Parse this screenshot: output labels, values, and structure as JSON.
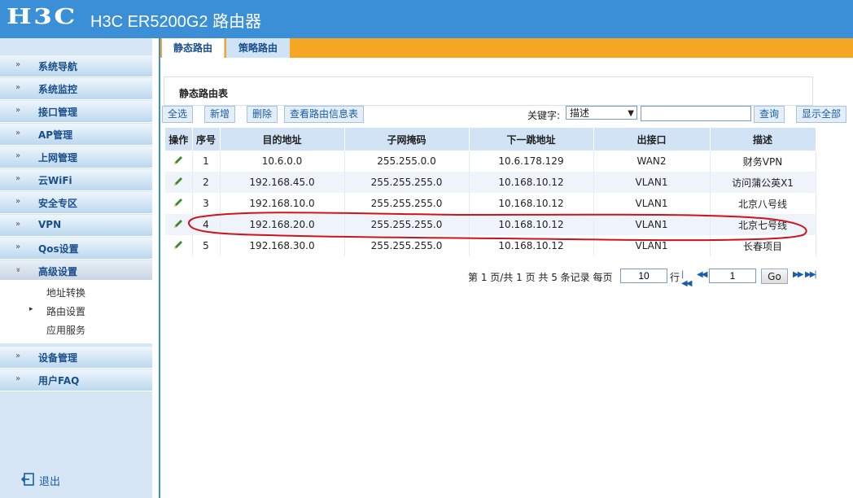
{
  "header": {
    "logo": "H3C",
    "title": "H3C ER5200G2 路由器"
  },
  "sidebar": {
    "items": [
      {
        "label": "系统导航"
      },
      {
        "label": "系统监控"
      },
      {
        "label": "接口管理"
      },
      {
        "label": "AP管理"
      },
      {
        "label": "上网管理"
      },
      {
        "label": "云WiFi"
      },
      {
        "label": "安全专区"
      },
      {
        "label": "VPN"
      },
      {
        "label": "Qos设置"
      },
      {
        "label": "高级设置"
      },
      {
        "label": "设备管理"
      },
      {
        "label": "用户FAQ"
      }
    ],
    "sub_items": [
      {
        "label": "地址转换"
      },
      {
        "label": "路由设置",
        "active": true
      },
      {
        "label": "应用服务"
      }
    ],
    "logout": "退出"
  },
  "tabs": [
    {
      "label": "静态路由",
      "active": true
    },
    {
      "label": "策略路由"
    }
  ],
  "panel": {
    "title": "静态路由表"
  },
  "toolbar": {
    "select_all": "全选",
    "add": "新增",
    "delete": "删除",
    "view_route_info": "查看路由信息表",
    "keyword_label": "关键字:",
    "keyword_select_value": "描述",
    "keyword_input_value": "",
    "query": "查询",
    "show_all": "显示全部"
  },
  "table": {
    "headers": [
      "操作",
      "序号",
      "目的地址",
      "子网掩码",
      "下一跳地址",
      "出接口",
      "描述"
    ],
    "rows": [
      {
        "index": "1",
        "dest": "10.6.0.0",
        "mask": "255.255.0.0",
        "next_hop": "10.6.178.129",
        "iface": "WAN2",
        "desc": "财务VPN"
      },
      {
        "index": "2",
        "dest": "192.168.45.0",
        "mask": "255.255.255.0",
        "next_hop": "10.168.10.12",
        "iface": "VLAN1",
        "desc": "访问蒲公英X1"
      },
      {
        "index": "3",
        "dest": "192.168.10.0",
        "mask": "255.255.255.0",
        "next_hop": "10.168.10.12",
        "iface": "VLAN1",
        "desc": "北京八号线"
      },
      {
        "index": "4",
        "dest": "192.168.20.0",
        "mask": "255.255.255.0",
        "next_hop": "10.168.10.12",
        "iface": "VLAN1",
        "desc": "北京七号线"
      },
      {
        "index": "5",
        "dest": "192.168.30.0",
        "mask": "255.255.255.0",
        "next_hop": "10.168.10.12",
        "iface": "VLAN1",
        "desc": "长春项目"
      }
    ]
  },
  "pager": {
    "summary": "第 1 页/共 1 页 共 5 条记录 每页",
    "per_page": "10",
    "rows_label": "行",
    "page_input": "1",
    "go": "Go"
  },
  "colors": {
    "header_blue": "#3a8fd6",
    "tab_orange": "#f5a623",
    "annotation_red": "#d0121b",
    "edit_icon_green": "#3a8a2a"
  }
}
